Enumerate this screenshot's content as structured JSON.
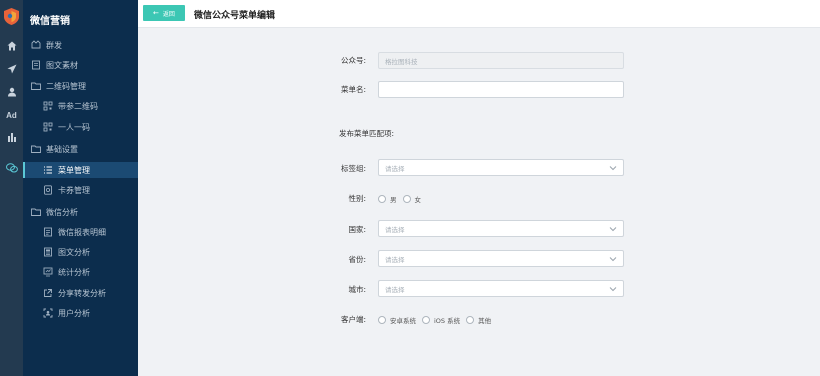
{
  "app": {
    "brand": "微信营销"
  },
  "rail": {
    "ad_label": "Ad"
  },
  "menu": {
    "items": [
      {
        "label": "群发"
      },
      {
        "label": "图文素材"
      },
      {
        "label": "二维码管理"
      },
      {
        "label": "带参二维码"
      },
      {
        "label": "一人一码"
      },
      {
        "label": "基础设置"
      },
      {
        "label": "菜单管理"
      },
      {
        "label": "卡券管理"
      },
      {
        "label": "微信分析"
      },
      {
        "label": "微信报表明细"
      },
      {
        "label": "图文分析"
      },
      {
        "label": "统计分析"
      },
      {
        "label": "分享转发分析"
      },
      {
        "label": "用户分析"
      }
    ]
  },
  "header": {
    "back_label": "返回",
    "title": "微信公众号菜单编辑"
  },
  "form": {
    "account": {
      "label": "公众号:",
      "value": "格拉图科技"
    },
    "menu_name": {
      "label": "菜单名:",
      "value": ""
    },
    "section_label": "发布菜单匹配项:",
    "tag_group": {
      "label": "标签组:",
      "placeholder": "请选择"
    },
    "gender": {
      "label": "性别:",
      "options": [
        "男",
        "女"
      ]
    },
    "country": {
      "label": "国家:",
      "placeholder": "请选择"
    },
    "province": {
      "label": "省份:",
      "placeholder": "请选择"
    },
    "city": {
      "label": "城市:",
      "placeholder": "请选择"
    },
    "client": {
      "label": "客户端:",
      "options": [
        "安卓系统",
        "iOS 系统",
        "其他"
      ]
    }
  }
}
